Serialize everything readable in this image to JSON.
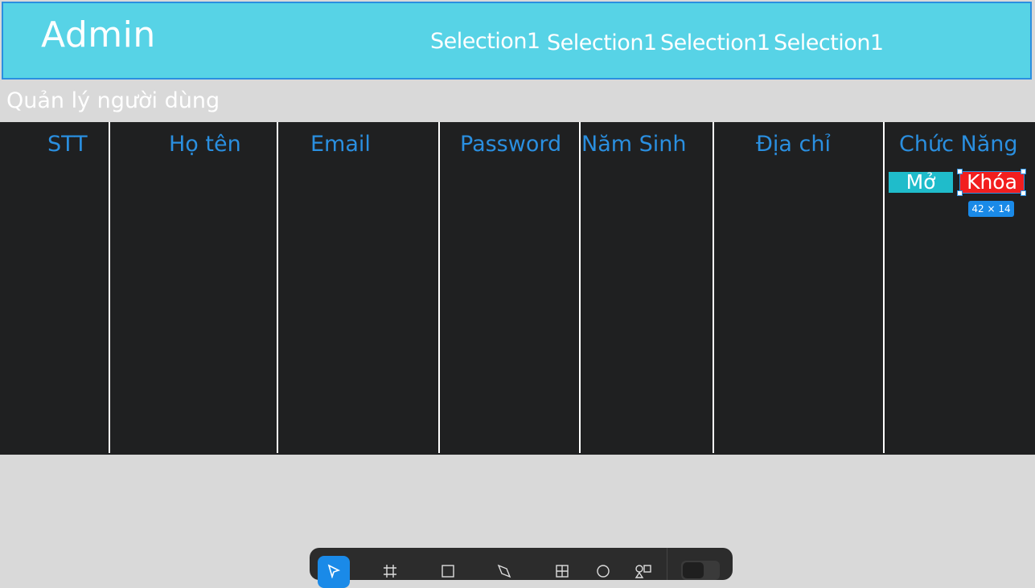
{
  "header": {
    "title": "Admin",
    "nav": [
      "Selection1",
      "Selection1",
      "Selection1",
      "Selection1"
    ]
  },
  "page": {
    "title": "Quản lý người dùng"
  },
  "table": {
    "columns": [
      "STT",
      "Họ tên",
      "Email",
      "Password",
      "Năm Sinh",
      "Địa chỉ",
      "Chức Năng"
    ],
    "actions": {
      "open": "Mở",
      "lock": "Khóa"
    }
  },
  "selection": {
    "size_label": "42 × 14"
  },
  "toolbar": {
    "tools": [
      "move-icon",
      "frame-icon",
      "rectangle-icon",
      "pen-icon",
      "layout-icon",
      "ellipse-icon",
      "shapes-icon"
    ],
    "active_tool": "move-icon"
  },
  "colors": {
    "header_bg": "#57d3e6",
    "accent": "#2a8fe0",
    "table_bg": "#1f2021",
    "open_btn": "#1fbccb",
    "lock_btn": "#f21e1e"
  }
}
